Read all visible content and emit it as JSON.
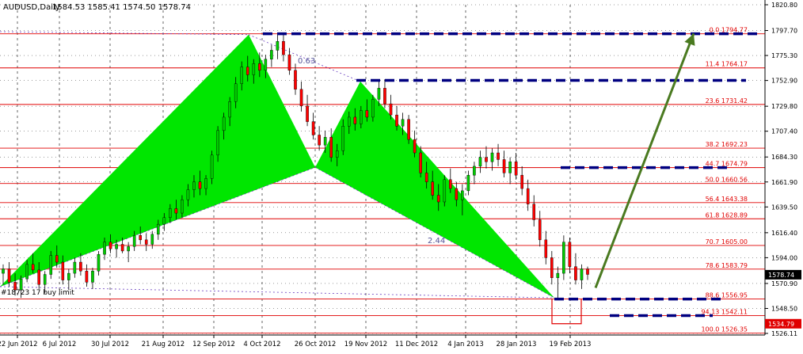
{
  "header": {
    "symbol": "AUDUSD,Daily",
    "ohlc": "1584.53 1585.41 1574.50 1578.74"
  },
  "pending_order_label": "#18723  17 buy limit",
  "price_badges": {
    "current": "1578.74",
    "stop": "1534.79"
  },
  "pattern_labels": {
    "upper_ratio": "0.63",
    "lower_ratio": "2.44"
  },
  "colors": {
    "background": "#ffffff",
    "bull_candle": "#00cc00",
    "bear_candle": "#ff0000",
    "pattern_fill": "#00e600",
    "fib_line": "#e00000",
    "level_dash": "#000080",
    "arrow": "#4a7a20",
    "dotted_pattern": "#6a3fbf",
    "current_badge": "#000000",
    "stop_badge": "#e00000"
  },
  "chart_data": {
    "type": "candlestick",
    "instrument": "AUDUSD,Daily",
    "ylim": [
      1526.11,
      1820.8
    ],
    "y_ticks": [
      "1820.80",
      "1797.70",
      "1775.30",
      "1752.90",
      "1729.80",
      "1707.40",
      "1684.30",
      "1661.90",
      "1639.50",
      "1616.40",
      "1594.00",
      "1570.90",
      "1548.50",
      "1526.11"
    ],
    "x_ticks": [
      "22 Jun 2012",
      "6 Jul 2012",
      "30 Jul 2012",
      "21 Aug 2012",
      "12 Sep 2012",
      "4 Oct 2012",
      "26 Oct 2012",
      "19 Nov 2012",
      "11 Dec 2012",
      "4 Jan 2013",
      "28 Jan 2013",
      "19 Feb 2013"
    ],
    "fib_levels": [
      {
        "label": "0.0 1794.77",
        "value": 1794.77
      },
      {
        "label": "11.4 1764.17",
        "value": 1764.17
      },
      {
        "label": "23.6 1731.42",
        "value": 1731.42
      },
      {
        "label": "38.2 1692.23",
        "value": 1692.23
      },
      {
        "label": "44.7 1674.79",
        "value": 1674.79
      },
      {
        "label": "50.0 1660.56",
        "value": 1660.56
      },
      {
        "label": "56.4 1643.38",
        "value": 1643.38
      },
      {
        "label": "61.8 1628.89",
        "value": 1628.89
      },
      {
        "label": "70.7 1605.00",
        "value": 1605.0
      },
      {
        "label": "78.6 1583.79",
        "value": 1583.79
      },
      {
        "label": "88.6 1556.95",
        "value": 1556.95
      },
      {
        "label": "94.13 1542.11",
        "value": 1542.11
      },
      {
        "label": "100.0 1526.35",
        "value": 1526.35
      }
    ],
    "pattern_points": [
      {
        "date": "22 Jun 2012",
        "price": 1568
      },
      {
        "date": "4 Oct 2012",
        "price": 1794
      },
      {
        "date": "26 Oct 2012",
        "price": 1675
      },
      {
        "date": "19 Nov 2012",
        "price": 1752
      },
      {
        "date": "19 Feb 2013",
        "price": 1558
      }
    ],
    "trade_levels": [
      1794.77,
      1753,
      1674.79,
      1556.95,
      1542.11
    ],
    "current_price": 1578.74,
    "stop_price": 1534.79,
    "candles": [
      {
        "o": 1580,
        "h": 1588,
        "l": 1570,
        "c": 1584
      },
      {
        "o": 1584,
        "h": 1590,
        "l": 1568,
        "c": 1572
      },
      {
        "o": 1572,
        "h": 1580,
        "l": 1560,
        "c": 1565
      },
      {
        "o": 1565,
        "h": 1578,
        "l": 1558,
        "c": 1575
      },
      {
        "o": 1575,
        "h": 1592,
        "l": 1572,
        "c": 1588
      },
      {
        "o": 1588,
        "h": 1598,
        "l": 1580,
        "c": 1583
      },
      {
        "o": 1583,
        "h": 1590,
        "l": 1566,
        "c": 1570
      },
      {
        "o": 1570,
        "h": 1582,
        "l": 1562,
        "c": 1579
      },
      {
        "o": 1579,
        "h": 1600,
        "l": 1575,
        "c": 1596
      },
      {
        "o": 1596,
        "h": 1605,
        "l": 1585,
        "c": 1590
      },
      {
        "o": 1590,
        "h": 1596,
        "l": 1570,
        "c": 1574
      },
      {
        "o": 1574,
        "h": 1584,
        "l": 1565,
        "c": 1580
      },
      {
        "o": 1580,
        "h": 1594,
        "l": 1576,
        "c": 1590
      },
      {
        "o": 1590,
        "h": 1598,
        "l": 1578,
        "c": 1582
      },
      {
        "o": 1582,
        "h": 1588,
        "l": 1568,
        "c": 1572
      },
      {
        "o": 1572,
        "h": 1585,
        "l": 1566,
        "c": 1582
      },
      {
        "o": 1582,
        "h": 1600,
        "l": 1578,
        "c": 1597
      },
      {
        "o": 1597,
        "h": 1612,
        "l": 1592,
        "c": 1608
      },
      {
        "o": 1608,
        "h": 1615,
        "l": 1598,
        "c": 1602
      },
      {
        "o": 1602,
        "h": 1610,
        "l": 1594,
        "c": 1606
      },
      {
        "o": 1606,
        "h": 1612,
        "l": 1598,
        "c": 1600
      },
      {
        "o": 1600,
        "h": 1608,
        "l": 1590,
        "c": 1604
      },
      {
        "o": 1604,
        "h": 1618,
        "l": 1600,
        "c": 1614
      },
      {
        "o": 1614,
        "h": 1622,
        "l": 1606,
        "c": 1610
      },
      {
        "o": 1610,
        "h": 1616,
        "l": 1600,
        "c": 1606
      },
      {
        "o": 1606,
        "h": 1618,
        "l": 1602,
        "c": 1615
      },
      {
        "o": 1615,
        "h": 1628,
        "l": 1610,
        "c": 1624
      },
      {
        "o": 1624,
        "h": 1634,
        "l": 1618,
        "c": 1630
      },
      {
        "o": 1630,
        "h": 1642,
        "l": 1625,
        "c": 1638
      },
      {
        "o": 1638,
        "h": 1646,
        "l": 1628,
        "c": 1634
      },
      {
        "o": 1634,
        "h": 1650,
        "l": 1630,
        "c": 1646
      },
      {
        "o": 1646,
        "h": 1660,
        "l": 1640,
        "c": 1655
      },
      {
        "o": 1655,
        "h": 1668,
        "l": 1648,
        "c": 1662
      },
      {
        "o": 1662,
        "h": 1672,
        "l": 1650,
        "c": 1656
      },
      {
        "o": 1656,
        "h": 1668,
        "l": 1650,
        "c": 1665
      },
      {
        "o": 1665,
        "h": 1690,
        "l": 1660,
        "c": 1686
      },
      {
        "o": 1686,
        "h": 1712,
        "l": 1680,
        "c": 1708
      },
      {
        "o": 1708,
        "h": 1724,
        "l": 1700,
        "c": 1720
      },
      {
        "o": 1720,
        "h": 1738,
        "l": 1712,
        "c": 1734
      },
      {
        "o": 1734,
        "h": 1756,
        "l": 1728,
        "c": 1750
      },
      {
        "o": 1750,
        "h": 1770,
        "l": 1744,
        "c": 1765
      },
      {
        "o": 1765,
        "h": 1775,
        "l": 1752,
        "c": 1758
      },
      {
        "o": 1758,
        "h": 1772,
        "l": 1750,
        "c": 1768
      },
      {
        "o": 1768,
        "h": 1778,
        "l": 1756,
        "c": 1762
      },
      {
        "o": 1762,
        "h": 1776,
        "l": 1755,
        "c": 1772
      },
      {
        "o": 1772,
        "h": 1785,
        "l": 1765,
        "c": 1780
      },
      {
        "o": 1780,
        "h": 1794,
        "l": 1772,
        "c": 1788
      },
      {
        "o": 1788,
        "h": 1795,
        "l": 1770,
        "c": 1776
      },
      {
        "o": 1776,
        "h": 1782,
        "l": 1758,
        "c": 1762
      },
      {
        "o": 1762,
        "h": 1768,
        "l": 1740,
        "c": 1745
      },
      {
        "o": 1745,
        "h": 1752,
        "l": 1725,
        "c": 1730
      },
      {
        "o": 1730,
        "h": 1740,
        "l": 1712,
        "c": 1716
      },
      {
        "o": 1716,
        "h": 1724,
        "l": 1700,
        "c": 1704
      },
      {
        "o": 1704,
        "h": 1712,
        "l": 1690,
        "c": 1695
      },
      {
        "o": 1695,
        "h": 1708,
        "l": 1688,
        "c": 1702
      },
      {
        "o": 1702,
        "h": 1710,
        "l": 1680,
        "c": 1684
      },
      {
        "o": 1684,
        "h": 1696,
        "l": 1676,
        "c": 1690
      },
      {
        "o": 1690,
        "h": 1718,
        "l": 1686,
        "c": 1712
      },
      {
        "o": 1712,
        "h": 1725,
        "l": 1705,
        "c": 1720
      },
      {
        "o": 1720,
        "h": 1728,
        "l": 1708,
        "c": 1714
      },
      {
        "o": 1714,
        "h": 1730,
        "l": 1710,
        "c": 1726
      },
      {
        "o": 1726,
        "h": 1736,
        "l": 1716,
        "c": 1720
      },
      {
        "o": 1720,
        "h": 1740,
        "l": 1716,
        "c": 1736
      },
      {
        "o": 1736,
        "h": 1752,
        "l": 1730,
        "c": 1746
      },
      {
        "o": 1746,
        "h": 1754,
        "l": 1728,
        "c": 1732
      },
      {
        "o": 1732,
        "h": 1740,
        "l": 1718,
        "c": 1722
      },
      {
        "o": 1722,
        "h": 1730,
        "l": 1708,
        "c": 1712
      },
      {
        "o": 1712,
        "h": 1724,
        "l": 1704,
        "c": 1718
      },
      {
        "o": 1718,
        "h": 1722,
        "l": 1696,
        "c": 1700
      },
      {
        "o": 1700,
        "h": 1708,
        "l": 1684,
        "c": 1688
      },
      {
        "o": 1688,
        "h": 1694,
        "l": 1666,
        "c": 1670
      },
      {
        "o": 1670,
        "h": 1680,
        "l": 1656,
        "c": 1662
      },
      {
        "o": 1662,
        "h": 1672,
        "l": 1646,
        "c": 1650
      },
      {
        "o": 1650,
        "h": 1660,
        "l": 1636,
        "c": 1644
      },
      {
        "o": 1644,
        "h": 1668,
        "l": 1640,
        "c": 1664
      },
      {
        "o": 1664,
        "h": 1674,
        "l": 1652,
        "c": 1656
      },
      {
        "o": 1656,
        "h": 1662,
        "l": 1640,
        "c": 1646
      },
      {
        "o": 1646,
        "h": 1660,
        "l": 1632,
        "c": 1654
      },
      {
        "o": 1654,
        "h": 1672,
        "l": 1650,
        "c": 1668
      },
      {
        "o": 1668,
        "h": 1680,
        "l": 1660,
        "c": 1676
      },
      {
        "o": 1676,
        "h": 1690,
        "l": 1670,
        "c": 1684
      },
      {
        "o": 1684,
        "h": 1694,
        "l": 1674,
        "c": 1680
      },
      {
        "o": 1680,
        "h": 1692,
        "l": 1672,
        "c": 1688
      },
      {
        "o": 1688,
        "h": 1696,
        "l": 1676,
        "c": 1682
      },
      {
        "o": 1682,
        "h": 1690,
        "l": 1666,
        "c": 1670
      },
      {
        "o": 1670,
        "h": 1684,
        "l": 1660,
        "c": 1680
      },
      {
        "o": 1680,
        "h": 1688,
        "l": 1664,
        "c": 1668
      },
      {
        "o": 1668,
        "h": 1676,
        "l": 1650,
        "c": 1656
      },
      {
        "o": 1656,
        "h": 1664,
        "l": 1636,
        "c": 1642
      },
      {
        "o": 1642,
        "h": 1650,
        "l": 1622,
        "c": 1628
      },
      {
        "o": 1628,
        "h": 1636,
        "l": 1604,
        "c": 1610
      },
      {
        "o": 1610,
        "h": 1618,
        "l": 1588,
        "c": 1594
      },
      {
        "o": 1594,
        "h": 1600,
        "l": 1570,
        "c": 1576
      },
      {
        "o": 1576,
        "h": 1586,
        "l": 1558,
        "c": 1580
      },
      {
        "o": 1580,
        "h": 1614,
        "l": 1574,
        "c": 1608
      },
      {
        "o": 1608,
        "h": 1612,
        "l": 1580,
        "c": 1586
      },
      {
        "o": 1586,
        "h": 1598,
        "l": 1570,
        "c": 1574
      },
      {
        "o": 1574,
        "h": 1588,
        "l": 1566,
        "c": 1584
      },
      {
        "o": 1584,
        "h": 1586,
        "l": 1574,
        "c": 1579
      }
    ]
  }
}
